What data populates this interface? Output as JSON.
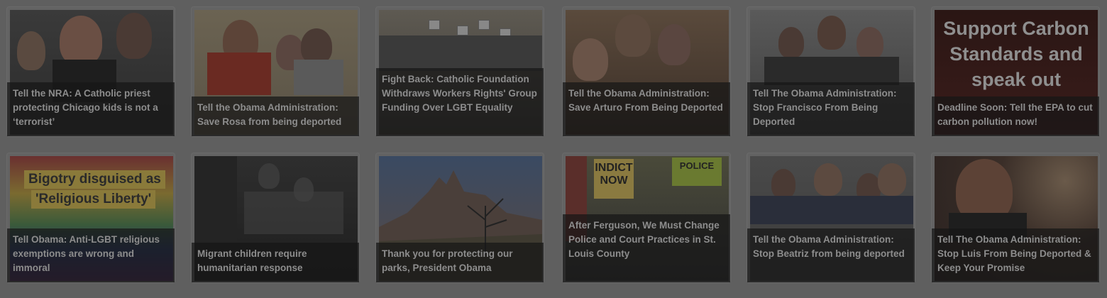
{
  "cards": [
    {
      "title": "Tell the NRA: A Catholic priest protecting Chicago kids is not a ‘terrorist’"
    },
    {
      "title": "Tell the Obama Administration: Save Rosa from being deported"
    },
    {
      "title": "Fight Back: Catholic Foundation Withdraws Workers Rights' Group Funding Over LGBT Equality"
    },
    {
      "title": "Tell the Obama Administration: Save Arturo From Being Deported"
    },
    {
      "title": "Tell The Obama Administration: Stop Francisco From Being Deported"
    },
    {
      "title": "Deadline Soon: Tell the EPA to cut carbon pollution now!",
      "image_text": "Support Carbon Standards and speak out"
    },
    {
      "title": "Tell Obama: Anti-LGBT religious exemptions are wrong and immoral",
      "image_text_1": "Bigotry disguised as",
      "image_text_2": "'Religious Liberty'"
    },
    {
      "title": "Migrant children require humanitarian response"
    },
    {
      "title": "Thank you for protecting our parks, President Obama"
    },
    {
      "title": "After Ferguson, We Must Change Police and Court Practices in St. Louis County",
      "image_text_1": "INDICT NOW",
      "image_text_2": "POLICE"
    },
    {
      "title": "Tell the Obama Administration: Stop Beatriz from being deported"
    },
    {
      "title": "Tell The Obama Administration: Stop Luis From Being Deported & Keep Your Promise"
    }
  ],
  "colors": {
    "overlay": "#5f5f5f",
    "caption_bg": "#161616",
    "caption_text": "#8d8d8d"
  }
}
